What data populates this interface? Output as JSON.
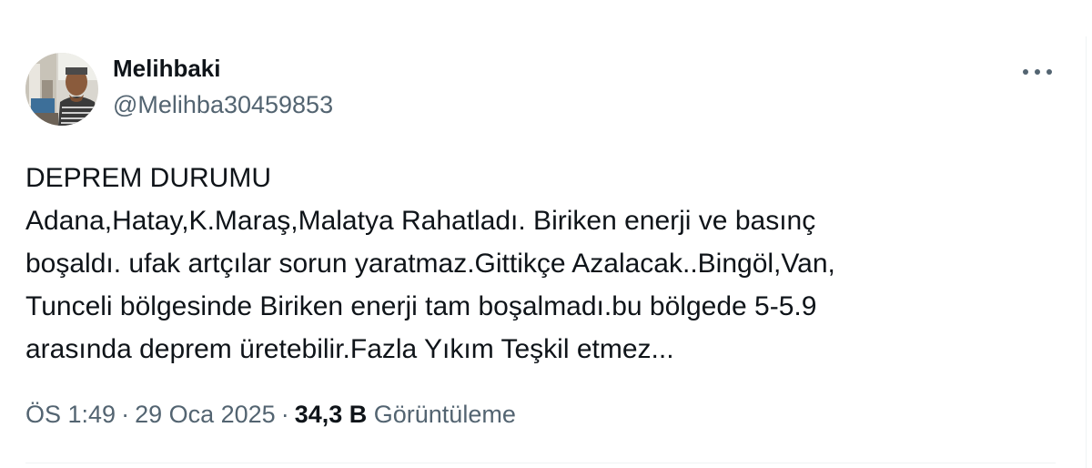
{
  "author": {
    "name": "Melihbaki",
    "handle": "@Melihba30459853",
    "avatar_icon": "profile-photo"
  },
  "more_icon": "more-horizontal-icon",
  "tweet": {
    "text": "DEPREM DURUMU\nAdana,Hatay,K.Maraş,Malatya Rahatladı. Biriken enerji ve basınç\nboşaldı. ufak artçılar sorun yaratmaz.Gittikçe Azalacak..Bingöl,Van,\nTunceli bölgesinde Biriken enerji tam boşalmadı.bu bölgede 5-5.9\narasında deprem üretebilir.Fazla Yıkım Teşkil etmez..."
  },
  "meta": {
    "time": "ÖS 1:49",
    "separator": "·",
    "date": "29 Oca 2025",
    "views_count": "34,3 B",
    "views_label": "Görüntüleme"
  },
  "colors": {
    "text_primary": "#0f1419",
    "text_secondary": "#536471",
    "border": "#eff3f4"
  }
}
